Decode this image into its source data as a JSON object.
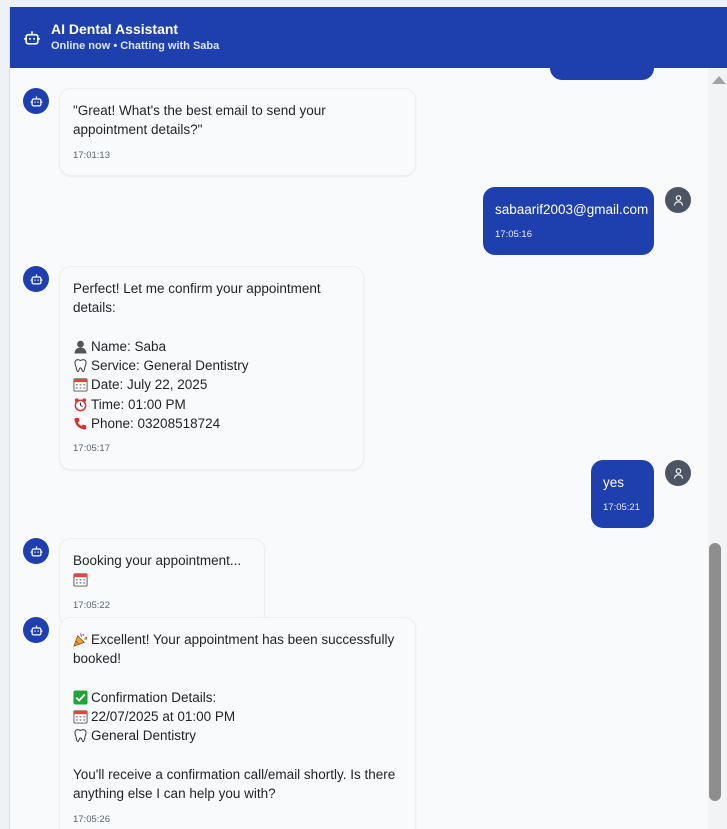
{
  "header": {
    "title": "AI Dental Assistant",
    "subtitle": "Online now • Chatting with Saba",
    "icon": "robot-icon"
  },
  "colors": {
    "brand": "#1e40af",
    "user_avatar": "#4b5563",
    "background": "#f8fafc"
  },
  "messages": [
    {
      "sender": "bot",
      "text": "\"Great! What's the best email to send your appointment details?\"",
      "time": "17:01:13"
    },
    {
      "sender": "user",
      "text": "sabaarif2003@gmail.com",
      "time": "17:05:16"
    },
    {
      "sender": "bot",
      "intro": "Perfect! Let me confirm your appointment details:",
      "details": [
        {
          "icon": "person-icon",
          "text": "Name: Saba"
        },
        {
          "icon": "tooth-icon",
          "text": "Service: General Dentistry"
        },
        {
          "icon": "calendar-icon",
          "text": "Date: July 22, 2025"
        },
        {
          "icon": "alarm-clock-icon",
          "text": "Time: 01:00 PM"
        },
        {
          "icon": "telephone-icon",
          "text": "Phone: 03208518724"
        }
      ],
      "time": "17:05:17"
    },
    {
      "sender": "user",
      "text": "yes",
      "time": "17:05:21"
    },
    {
      "sender": "bot",
      "text": "Booking your appointment...",
      "trailing_icon": "calendar-icon",
      "time": "17:05:22"
    },
    {
      "sender": "bot",
      "lead_icon": "party-popper-icon",
      "intro": "Excellent! Your appointment has been successfully booked!",
      "heading_icon": "check-mark-icon",
      "heading": "Confirmation Details:",
      "details": [
        {
          "icon": "calendar-icon",
          "text": "22/07/2025 at 01:00 PM"
        },
        {
          "icon": "tooth-icon",
          "text": "General Dentistry"
        }
      ],
      "closing": "You'll receive a confirmation call/email shortly. Is there anything else I can help you with?",
      "time": "17:05:26"
    }
  ],
  "scrollbar": {
    "position_fraction": 0.62
  }
}
